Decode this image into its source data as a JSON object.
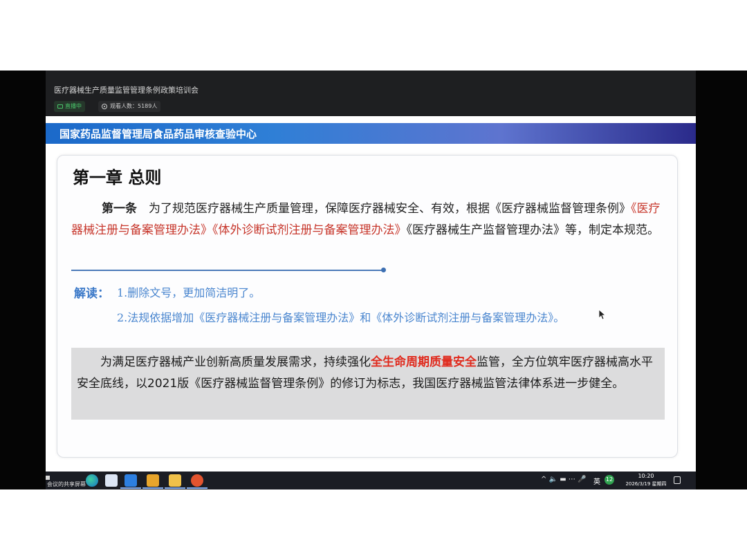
{
  "meeting": {
    "title": "医疗器械生产质量监管管理条例政策培训会",
    "live_label": "直播中",
    "viewers_label": "观看人数：5189人"
  },
  "slide": {
    "banner": "国家药品监督管理局食品药品审核查验中心",
    "chapter_title": "第一章 总则",
    "article": {
      "label": "第一条",
      "text_a": "为了规范医疗器械生产质量管理，保障医疗器械安全、有效，根据《医疗器械监督管理条例》",
      "red_a": "《医疗器械注册与备案管理办法》《体外诊断试剂注册与备案管理办法》",
      "text_b": "《医疗器械生产监督管理办法》等，制定本规范。"
    },
    "interpretation": {
      "label": "解读：",
      "point_1": "1.删除文号，更加简洁明了。",
      "point_2": "2.法规依据增加《医疗器械注册与备案管理办法》和《体外诊断试剂注册与备案管理办法》。"
    },
    "summary": {
      "text_a": "为满足医疗器械产业创新高质量发展需求，持续强化",
      "highlight": "全生命周期质量安全",
      "text_b": "监管，全方位筑牢医疗器械高水平安全底线，以2021版《医疗器械监督管理条例》的修订为标志，我国医疗器械监管法律体系进一步健全。"
    }
  },
  "taskbar": {
    "share_label": "会议的共享屏幕",
    "tray_icons": "^ 🔈 ▬ ⋯ 🎤",
    "language": "英",
    "badge": "12",
    "time": "10:20",
    "date": "2026/3/19 星期四"
  },
  "colors": {
    "banner_start": "#1b69c9",
    "banner_end": "#2a2a8a",
    "red_text": "#c7362b",
    "highlight": "#e02a1d",
    "interp_blue": "#4a86cf"
  }
}
